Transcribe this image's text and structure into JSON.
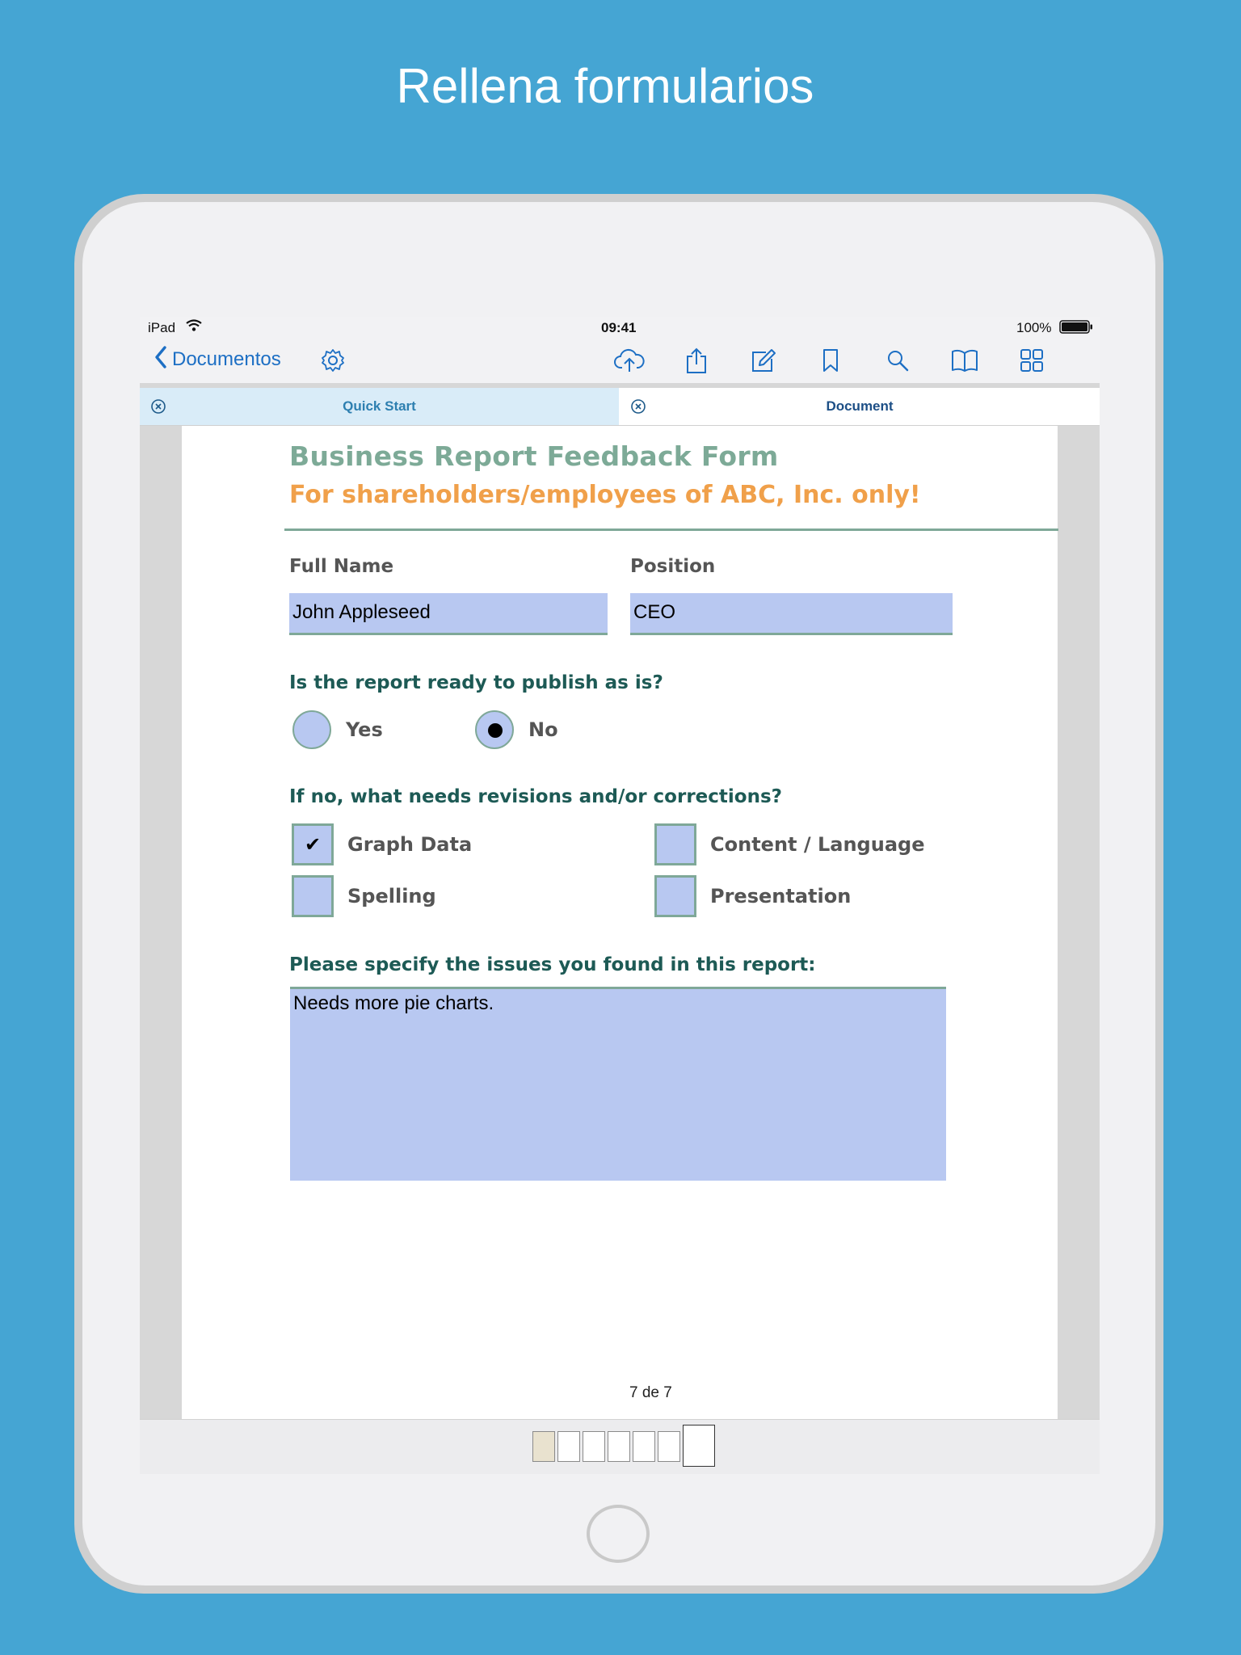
{
  "promo": {
    "title": "Rellena formularios"
  },
  "status_bar": {
    "device": "iPad",
    "time": "09:41",
    "battery": "100%"
  },
  "nav": {
    "back_label": "Documentos",
    "icons": [
      "settings-icon",
      "cloud-upload-icon",
      "share-icon",
      "edit-icon",
      "bookmark-icon",
      "search-icon",
      "book-icon",
      "grid-icon"
    ]
  },
  "tabs": [
    {
      "label": "Quick Start",
      "active": false
    },
    {
      "label": "Document",
      "active": true
    }
  ],
  "form": {
    "title": "Business Report Feedback Form",
    "subtitle": "For shareholders/employees of ABC, Inc. only!",
    "full_name_label": "Full Name",
    "full_name_value": "John Appleseed",
    "position_label": "Position",
    "position_value": "CEO",
    "publish_question": "Is the report ready to publish as is?",
    "radio_yes": "Yes",
    "radio_no": "No",
    "selected_radio": "No",
    "revisions_question": "If no, what needs revisions and/or corrections?",
    "checkboxes": [
      {
        "label": "Graph Data",
        "checked": true,
        "mark": "✔"
      },
      {
        "label": "Content / Language",
        "checked": false
      },
      {
        "label": "Spelling",
        "checked": false
      },
      {
        "label": "Presentation",
        "checked": false
      }
    ],
    "issues_question": "Please specify the issues you found in this report:",
    "issues_value": "Needs more pie charts."
  },
  "page_indicator": "7 de 7",
  "thumbnails": {
    "count": 7,
    "current": 7
  },
  "colors": {
    "background": "#45a5d3",
    "accent_blue": "#1d6fc4",
    "form_title": "#7daa97",
    "form_subtitle": "#f0a04a",
    "field_fill": "#b8c8f1",
    "question_text": "#1d5a55"
  }
}
